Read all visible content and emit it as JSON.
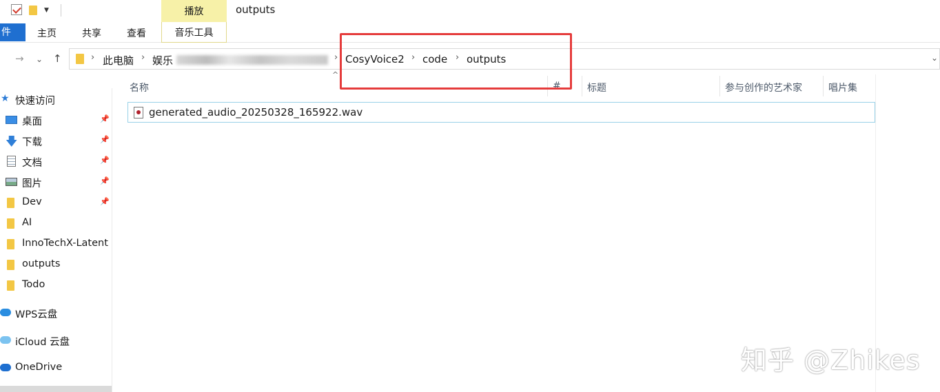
{
  "window": {
    "title": "outputs"
  },
  "ribbon": {
    "context_tab_top": "播放",
    "file_tab": "件",
    "tabs": [
      "主页",
      "共享",
      "查看"
    ],
    "context_tab_bottom": "音乐工具"
  },
  "address": {
    "crumbs": [
      "此电脑",
      "娱乐",
      "CosyVoice2",
      "code",
      "outputs"
    ]
  },
  "sidebar": {
    "items": [
      {
        "label": "快速访问",
        "icon": "star-icon",
        "pinned": false
      },
      {
        "label": "桌面",
        "icon": "desktop-icon",
        "pinned": true
      },
      {
        "label": "下载",
        "icon": "download-icon",
        "pinned": true
      },
      {
        "label": "文档",
        "icon": "document-icon",
        "pinned": true
      },
      {
        "label": "图片",
        "icon": "pictures-icon",
        "pinned": true
      },
      {
        "label": "Dev",
        "icon": "folder-icon",
        "pinned": true
      },
      {
        "label": "AI",
        "icon": "folder-icon",
        "pinned": false
      },
      {
        "label": "InnoTechX-Latent",
        "icon": "folder-icon",
        "pinned": false
      },
      {
        "label": "outputs",
        "icon": "folder-icon",
        "pinned": false
      },
      {
        "label": "Todo",
        "icon": "folder-icon",
        "pinned": false
      },
      {
        "label": "WPS云盘",
        "icon": "cloud-icon",
        "pinned": false
      },
      {
        "label": "iCloud 云盘",
        "icon": "cloud-icon",
        "pinned": false
      },
      {
        "label": "OneDrive",
        "icon": "cloud-icon",
        "pinned": false
      }
    ]
  },
  "columns": [
    "名称",
    "#",
    "标题",
    "参与创作的艺术家",
    "唱片集"
  ],
  "files": [
    {
      "name": "generated_audio_20250328_165922.wav"
    }
  ],
  "watermark": "知乎 @Zhikes",
  "colors": {
    "accent": "#1f6fd0",
    "context_tab": "#f7f1a8",
    "highlight": "#e53b3b",
    "folder": "#f3c744"
  }
}
